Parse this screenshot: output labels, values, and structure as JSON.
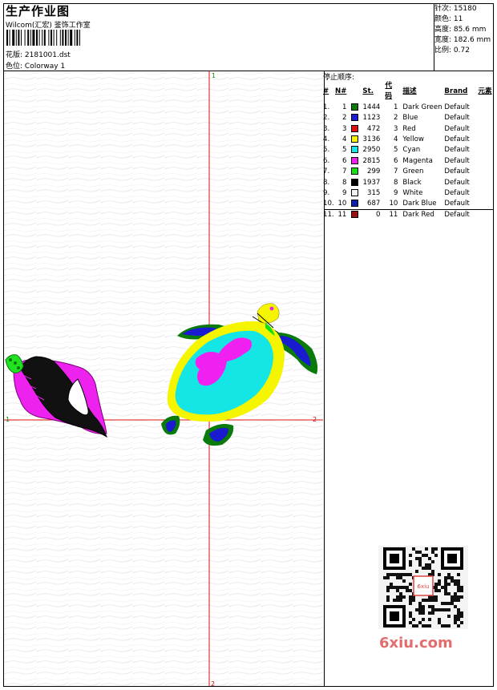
{
  "header": {
    "title": "生产作业图",
    "subtitle": "Wilcom(汇宏) 鉴饰工作室",
    "design_label": "花版:",
    "design_value": "2181001.dst",
    "colorway_label": "色位:",
    "colorway_value": "Colorway 1"
  },
  "stats": {
    "stitches_label": "针次:",
    "stitches_value": "15180",
    "colors_label": "颜色:",
    "colors_value": "11",
    "height_label": "高度:",
    "height_value": "85.6 mm",
    "width_label": "宽度:",
    "width_value": "182.6 mm",
    "scale_label": "比例:",
    "scale_value": "0.72"
  },
  "stop_sequence": {
    "label": "停止顺序:",
    "headers": [
      "#",
      "N#",
      "St.",
      "代码",
      "描述",
      "Brand",
      "元素"
    ],
    "rows": [
      {
        "idx": "1.",
        "n": "1",
        "color": "#0a7a0a",
        "st": "1444",
        "code": "1",
        "desc": "Dark Green",
        "brand": "Default"
      },
      {
        "idx": "2.",
        "n": "2",
        "color": "#1a1ad0",
        "st": "1123",
        "code": "2",
        "desc": "Blue",
        "brand": "Default"
      },
      {
        "idx": "3.",
        "n": "3",
        "color": "#e01010",
        "st": "472",
        "code": "3",
        "desc": "Red",
        "brand": "Default"
      },
      {
        "idx": "4.",
        "n": "4",
        "color": "#f5f500",
        "st": "3136",
        "code": "4",
        "desc": "Yellow",
        "brand": "Default"
      },
      {
        "idx": "5.",
        "n": "5",
        "color": "#14e5e5",
        "st": "2950",
        "code": "5",
        "desc": "Cyan",
        "brand": "Default"
      },
      {
        "idx": "6.",
        "n": "6",
        "color": "#f020f0",
        "st": "2815",
        "code": "6",
        "desc": "Magenta",
        "brand": "Default"
      },
      {
        "idx": "7.",
        "n": "7",
        "color": "#12e012",
        "st": "299",
        "code": "7",
        "desc": "Green",
        "brand": "Default"
      },
      {
        "idx": "8.",
        "n": "8",
        "color": "#000000",
        "st": "1937",
        "code": "8",
        "desc": "Black",
        "brand": "Default"
      },
      {
        "idx": "9.",
        "n": "9",
        "color": "#f2f2f2",
        "st": "315",
        "code": "9",
        "desc": "White",
        "brand": "Default"
      },
      {
        "idx": "10.",
        "n": "10",
        "color": "#0d1ea8",
        "st": "687",
        "code": "10",
        "desc": "Dark Blue",
        "brand": "Default"
      },
      {
        "idx": "11.",
        "n": "11",
        "color": "#9a1010",
        "st": "0",
        "code": "11",
        "desc": "Dark Red",
        "brand": "Default"
      }
    ]
  },
  "canvas": {
    "marker_top": "1",
    "marker_left": "1",
    "marker_right": "2",
    "marker_bottom": "2",
    "crosshair_color": "#e01010"
  },
  "watermark": {
    "text": "6xiu.com",
    "qr_stamp": "6xiu"
  }
}
